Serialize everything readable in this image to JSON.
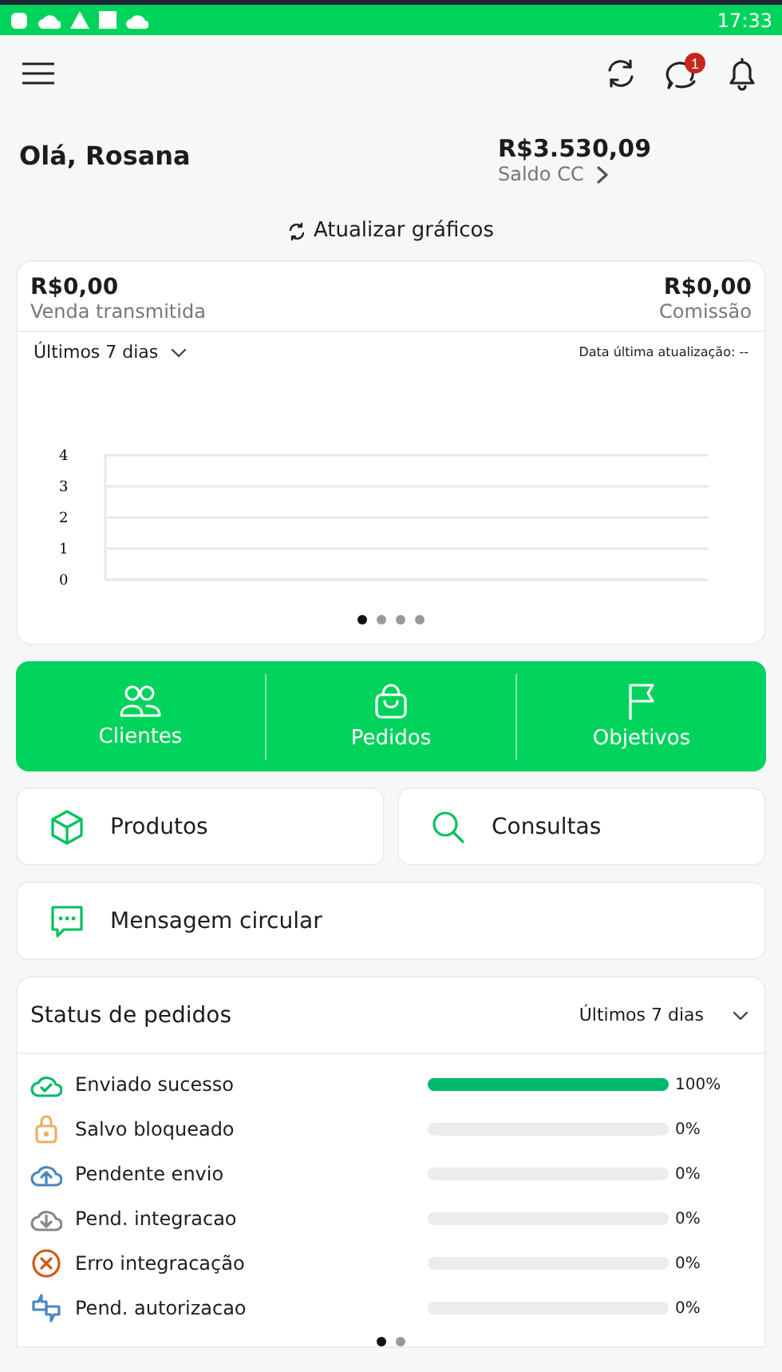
{
  "status_bar": {
    "time": "17:33"
  },
  "header": {
    "notification_badge": "1"
  },
  "greeting": "Olá, Rosana",
  "balance": {
    "amount": "R$3.530,09",
    "label": "Saldo CC"
  },
  "refresh_link": "Atualizar gráficos",
  "sales_card": {
    "left_value": "R$0,00",
    "left_label": "Venda transmitida",
    "right_value": "R$0,00",
    "right_label": "Comissão",
    "period": "Últimos 7 dias",
    "last_update": "Data última atualização: --",
    "chart_axis_labels": [
      "4",
      "3",
      "2",
      "1",
      "0"
    ],
    "dots": [
      {
        "selected": true
      },
      {
        "selected": false
      },
      {
        "selected": false
      },
      {
        "selected": false
      }
    ]
  },
  "quick_actions": [
    {
      "kind": "clients",
      "label": "Clientes"
    },
    {
      "kind": "orders",
      "label": "Pedidos"
    },
    {
      "kind": "goals",
      "label": "Objetivos"
    }
  ],
  "tiles": [
    {
      "kind": "box",
      "label": "Produtos"
    },
    {
      "kind": "search",
      "label": "Consultas"
    }
  ],
  "message_tile": {
    "label": "Mensagem circular"
  },
  "order_status": {
    "title": "Status de pedidos",
    "period": "Últimos 7 dias",
    "rows": [
      {
        "kind": "sent",
        "label": "Enviado sucesso",
        "level": 1,
        "reading": "100%"
      },
      {
        "kind": "locked",
        "label": "Salvo bloqueado",
        "level": 0,
        "reading": "0%"
      },
      {
        "kind": "upload",
        "label": "Pendente envio",
        "level": 0,
        "reading": "0%"
      },
      {
        "kind": "download",
        "label": "Pend. integracao",
        "level": 0,
        "reading": "0%"
      },
      {
        "kind": "error",
        "label": "Erro integracação",
        "level": 0,
        "reading": "0%"
      },
      {
        "kind": "auth",
        "label": "Pend. autorizacao",
        "level": 0,
        "reading": "0%"
      }
    ],
    "dots": [
      {
        "selected": true
      },
      {
        "selected": false
      }
    ]
  }
}
